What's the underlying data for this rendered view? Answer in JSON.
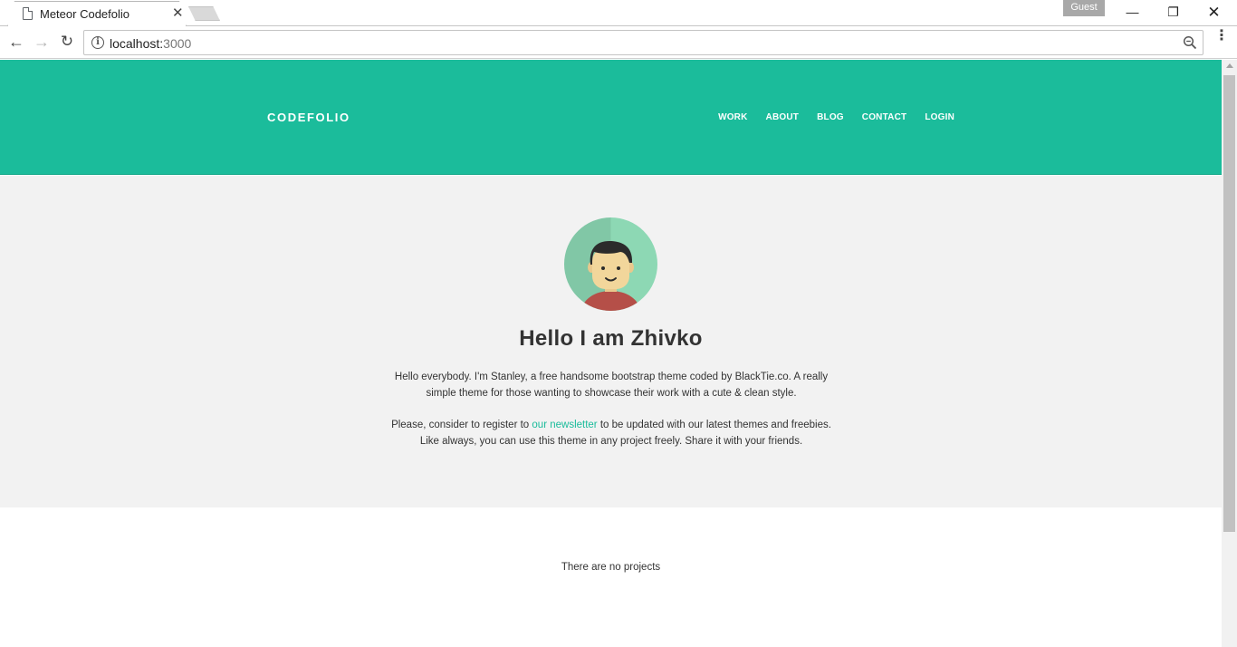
{
  "browser": {
    "tab_title": "Meteor Codefolio",
    "tab_close": "✕",
    "guest_label": "Guest",
    "url_host": "localhost:",
    "url_port": "3000",
    "win_minimize": "—",
    "win_restore": "❐",
    "win_close": "✕",
    "back_glyph": "←",
    "forward_glyph": "→",
    "reload_glyph": "↻",
    "info_glyph": "i",
    "menu_glyph": "⋮"
  },
  "site": {
    "brand": "CODEFOLIO",
    "nav": [
      {
        "label": "WORK"
      },
      {
        "label": "ABOUT"
      },
      {
        "label": "BLOG"
      },
      {
        "label": "CONTACT"
      },
      {
        "label": "LOGIN"
      }
    ],
    "accent_color": "#1bbc9b"
  },
  "hero": {
    "title": "Hello I am Zhivko",
    "paragraph1": "Hello everybody. I'm Stanley, a free handsome bootstrap theme coded by BlackTie.co. A really simple theme for those wanting to showcase their work with a cute & clean style.",
    "paragraph2_before": "Please, consider to register to ",
    "paragraph2_link": "our newsletter",
    "paragraph2_after": " to be updated with our latest themes and freebies. Like always, you can use this theme in any project freely. Share it with your friends.",
    "avatar_icon": "user-avatar-illustration"
  },
  "projects": {
    "empty_text": "There are no projects"
  }
}
